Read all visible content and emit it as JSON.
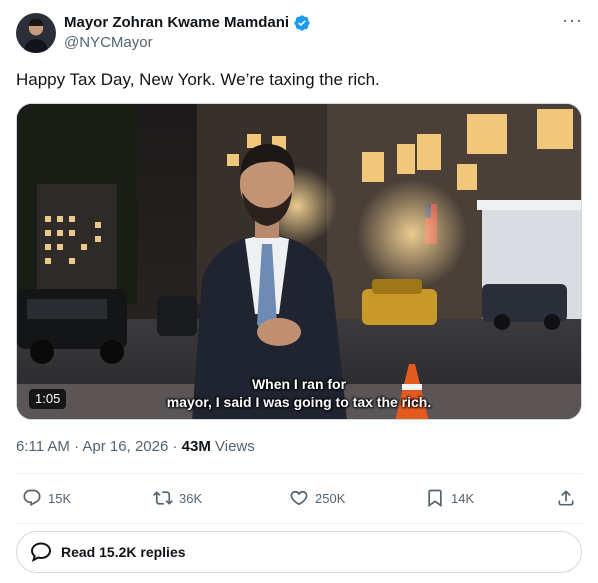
{
  "author": {
    "display_name": "Mayor Zohran Kwame Mamdani",
    "handle": "@NYCMayor",
    "verified": true,
    "verified_color": "#1d9bf0"
  },
  "tweet": {
    "text": "Happy Tax Day, New York. We’re taxing the rich."
  },
  "video": {
    "duration": "1:05",
    "caption_line1": "When I ran for",
    "caption_line2": "mayor, I said I was going to tax the rich."
  },
  "meta": {
    "timestamp": "6:11 AM · Apr 16, 2026 · ",
    "views_count": "43M",
    "views_label": " Views"
  },
  "actions": {
    "replies": "15K",
    "reposts": "36K",
    "likes": "250K",
    "bookmarks": "14K"
  },
  "read_replies": {
    "label": "Read 15.2K replies"
  },
  "icons": {
    "more": "more-icon",
    "reply": "reply-icon",
    "repost": "repost-icon",
    "like": "heart-icon",
    "bookmark": "bookmark-icon",
    "share": "share-icon",
    "bubble": "speech-bubble-icon"
  }
}
